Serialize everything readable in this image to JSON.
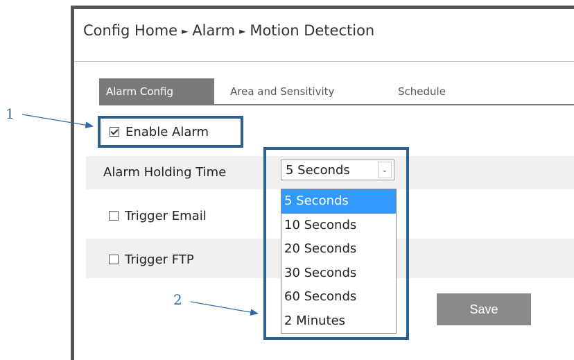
{
  "breadcrumb": {
    "items": [
      "Config Home",
      "Alarm",
      "Motion Detection"
    ],
    "separator": "►"
  },
  "tabs": [
    {
      "label": "Alarm Config",
      "active": true
    },
    {
      "label": "Area and Sensitivity",
      "active": false
    },
    {
      "label": "Schedule",
      "active": false
    }
  ],
  "enable_alarm": {
    "label": "Enable Alarm",
    "checked": true
  },
  "holding_time": {
    "label": "Alarm Holding Time",
    "selected": "5 Seconds",
    "options": [
      "5 Seconds",
      "10 Seconds",
      "20 Seconds",
      "30 Seconds",
      "60 Seconds",
      "2 Minutes"
    ]
  },
  "trigger_email": {
    "label": "Trigger Email",
    "checked": false
  },
  "trigger_ftp": {
    "label": "Trigger FTP",
    "checked": false
  },
  "save_label": "Save",
  "callouts": {
    "one": "1",
    "two": "2"
  },
  "colors": {
    "highlight": "#2e5f91",
    "callout": "#2e6ca8",
    "tab_active": "#7a7a7a",
    "option_selected": "#3399ff"
  }
}
